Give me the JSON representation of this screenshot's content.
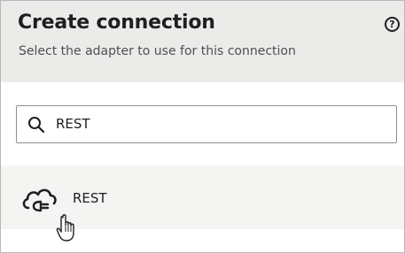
{
  "dialog": {
    "title": "Create connection",
    "subtitle": "Select the adapter to use for this connection",
    "help_icon": "help-circle-icon",
    "help_glyph": "?"
  },
  "search": {
    "icon": "search-icon",
    "value": "REST"
  },
  "results": [
    {
      "label": "REST",
      "icon": "cloud-plug-icon"
    }
  ],
  "cursor": "pointer-hand-icon"
}
